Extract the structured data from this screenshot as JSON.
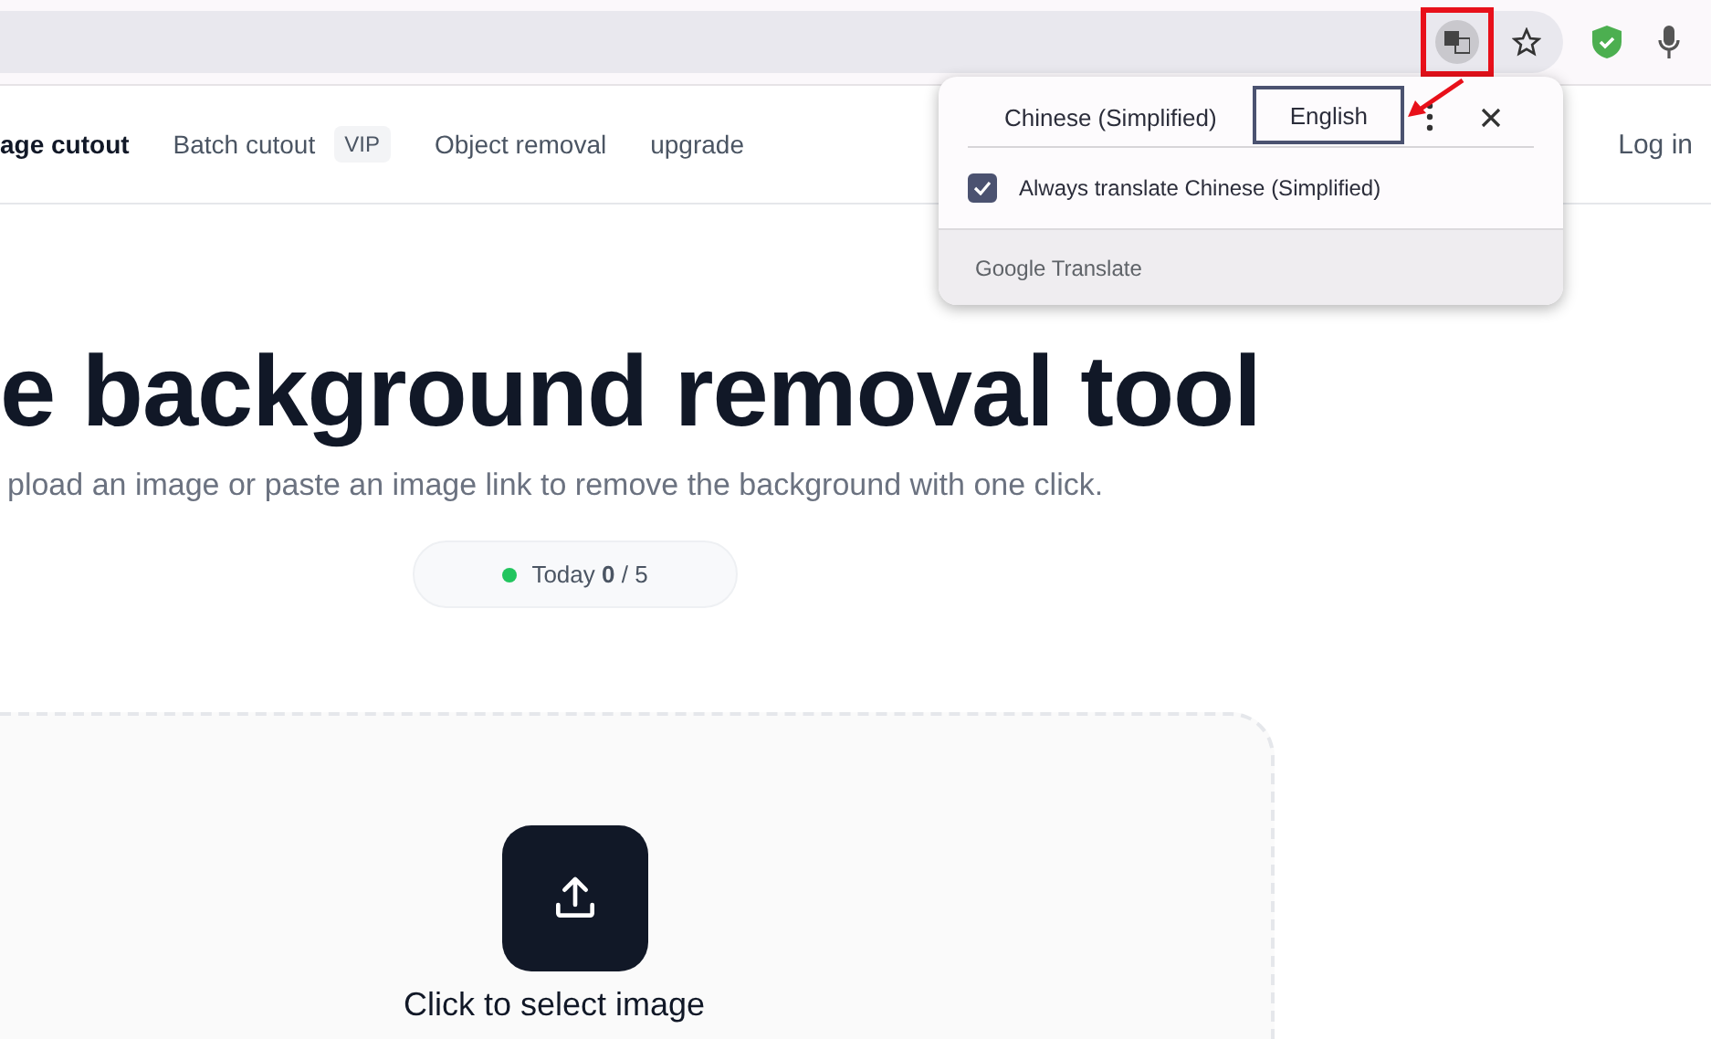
{
  "browser": {
    "translate_highlighted": true
  },
  "nav": {
    "items": [
      {
        "label": "age cutout",
        "selected": true
      },
      {
        "label": "Batch cutout",
        "selected": false,
        "badge": "VIP"
      },
      {
        "label": "Object removal",
        "selected": false
      },
      {
        "label": "upgrade",
        "selected": false
      }
    ],
    "login": "Log in"
  },
  "translate_popup": {
    "languages": [
      {
        "label": "Chinese (Simplified)",
        "selected": false
      },
      {
        "label": "English",
        "selected": true
      }
    ],
    "always_translate": {
      "label": "Always translate Chinese (Simplified)",
      "checked": true
    },
    "footer": "Google Translate"
  },
  "hero": {
    "title": "e background removal tool",
    "subtitle": "pload an image or paste an image link to remove the background with one click.",
    "counter": {
      "text": "Today **0** / 5",
      "color": "#22c55e"
    }
  },
  "upload": {
    "label": "Click to select image"
  }
}
